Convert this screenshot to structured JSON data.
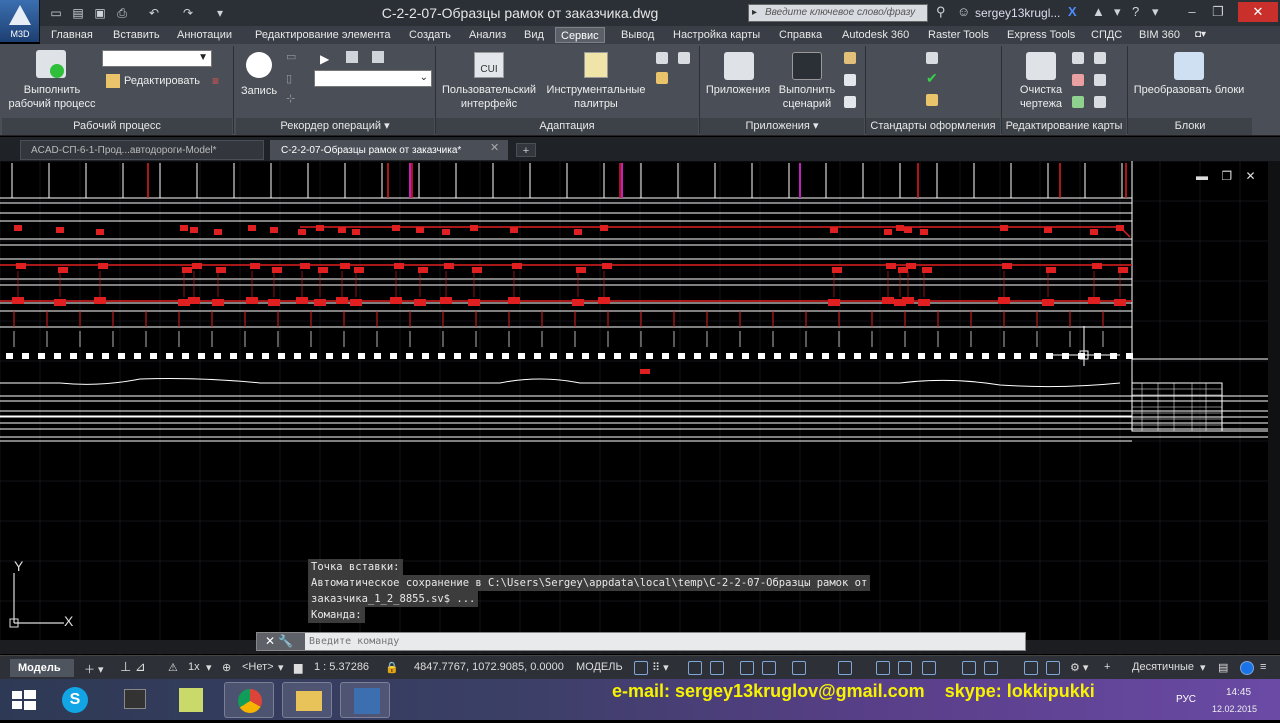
{
  "app": {
    "logo_text": "M3D",
    "doc_title": "С-2-2-07-Образцы рамок от заказчика.dwg",
    "search_placeholder": "Введите ключевое слово/фразу",
    "user_name": "sergey13krugl..."
  },
  "ribbon_tabs": [
    "Главная",
    "Вставить",
    "Аннотации",
    "Редактирование элемента",
    "Создать",
    "Анализ",
    "Вид",
    "Сервис",
    "Вывод",
    "Настройка карты",
    "Справка",
    "Autodesk 360",
    "Raster Tools",
    "Express Tools",
    "СПДС",
    "BIM 360"
  ],
  "active_tab": "Сервис",
  "ribbon": {
    "workflow": {
      "run_label_1": "Выполнить",
      "run_label_2": "рабочий процесс",
      "edit_label": "Редактировать",
      "title": "Рабочий процесс"
    },
    "recorder": {
      "record_label": "Запись",
      "title": "Рекордер операций"
    },
    "adapt": {
      "cui_text": "CUI",
      "ui_label_1": "Пользовательский",
      "ui_label_2": "интерфейс",
      "palettes_label_1": "Инструментальные",
      "palettes_label_2": "палитры",
      "title": "Адаптация"
    },
    "apps": {
      "apps_label": "Приложения",
      "script_label_1": "Выполнить",
      "script_label_2": "сценарий",
      "title": "Приложения"
    },
    "standards": {
      "title": "Стандарты оформления"
    },
    "mapedit": {
      "clean_label_1": "Очистка",
      "clean_label_2": "чертежа",
      "title": "Редактирование карты"
    },
    "blocks": {
      "convert_label": "Преобразовать блоки",
      "title": "Блоки"
    }
  },
  "file_tabs": [
    {
      "label": "ACAD-СП-6-1-Прод...автодороги-Model*"
    },
    {
      "label": "С-2-2-07-Образцы рамок от заказчика*"
    }
  ],
  "command": {
    "history": [
      "Точка вставки:",
      "Автоматическое сохранение в C:\\Users\\Sergey\\appdata\\local\\temp\\С-2-2-07-Образцы рамок от",
      "заказчика_1_2_8855.sv$ ...",
      "Команда:"
    ],
    "placeholder": "Введите команду"
  },
  "ucs": {
    "x_label": "X",
    "y_label": "Y"
  },
  "status": {
    "model_tab": "Модель",
    "scale_mult": "1x",
    "layer_filter": "<Нет>",
    "scale": "1 : 5.37286",
    "coords": "4847.7767, 1072.9085, 0.0000",
    "space": "МОДЕЛЬ",
    "units": "Десятичные"
  },
  "taskbar": {
    "contact_email": "e-mail: sergey13kruglov@gmail.com",
    "contact_skype": "skype: lokkipukki",
    "lang": "РУС",
    "time": "14:45",
    "date": "12.02.2015"
  },
  "colors": {
    "accent": "#3b6fb0",
    "drawing_red": "#e02020",
    "drawing_white": "#ffffff",
    "drawing_magenta": "#c020c0",
    "contact_yellow": "#f7f300"
  }
}
